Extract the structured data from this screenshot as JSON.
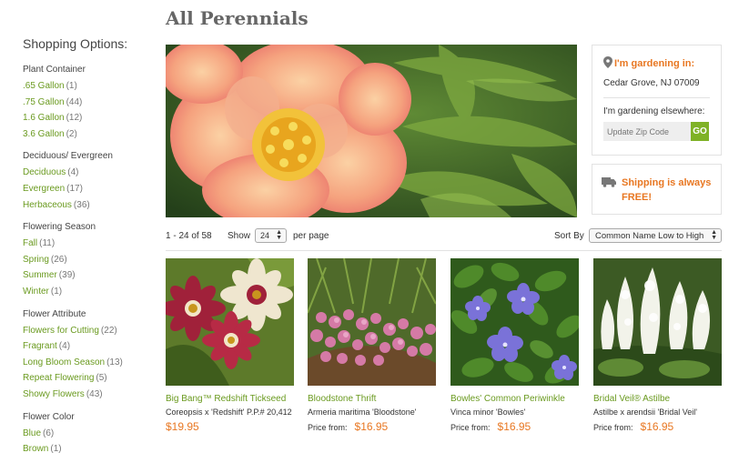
{
  "page_title": "All Perennials",
  "sidebar": {
    "heading": "Shopping Options:",
    "groups": [
      {
        "title": "Plant Container",
        "options": [
          {
            "label": ".65 Gallon",
            "count": "(1)"
          },
          {
            "label": ".75 Gallon",
            "count": "(44)"
          },
          {
            "label": "1.6 Gallon",
            "count": "(12)"
          },
          {
            "label": "3.6 Gallon",
            "count": "(2)"
          }
        ]
      },
      {
        "title": "Deciduous/ Evergreen",
        "options": [
          {
            "label": "Deciduous",
            "count": "(4)"
          },
          {
            "label": "Evergreen",
            "count": "(17)"
          },
          {
            "label": "Herbaceous",
            "count": "(36)"
          }
        ]
      },
      {
        "title": "Flowering Season",
        "options": [
          {
            "label": "Fall",
            "count": "(11)"
          },
          {
            "label": "Spring",
            "count": "(26)"
          },
          {
            "label": "Summer",
            "count": "(39)"
          },
          {
            "label": "Winter",
            "count": "(1)"
          }
        ]
      },
      {
        "title": "Flower Attribute",
        "options": [
          {
            "label": "Flowers for Cutting",
            "count": "(22)"
          },
          {
            "label": "Fragrant",
            "count": "(4)"
          },
          {
            "label": "Long Bloom Season",
            "count": "(13)"
          },
          {
            "label": "Repeat Flowering",
            "count": "(5)"
          },
          {
            "label": "Showy Flowers",
            "count": "(43)"
          }
        ]
      },
      {
        "title": "Flower Color",
        "options": [
          {
            "label": "Blue",
            "count": "(6)"
          },
          {
            "label": "Brown",
            "count": "(1)"
          }
        ]
      }
    ]
  },
  "location": {
    "icon": "map-pin-icon",
    "heading": "I'm gardening in:",
    "city": "Cedar Grove, NJ 07009",
    "elsewhere_label": "I'm gardening elsewhere:",
    "zip_placeholder": "Update Zip Code",
    "go_label": "GO"
  },
  "shipping": {
    "icon": "truck-icon",
    "text_line1": "Shipping is always",
    "text_line2": "FREE!"
  },
  "toolbar": {
    "range": "1 - 24 of 58",
    "show_label": "Show",
    "per_page_value": "24",
    "per_page_label": "per page",
    "sort_label": "Sort By",
    "sort_value": "Common Name Low to High"
  },
  "products": [
    {
      "name": "Big Bang™ Redshift Tickseed",
      "botanical": "Coreopsis x 'Redshift' P.P.# 20,412",
      "price_from": "",
      "price": "$19.95"
    },
    {
      "name": "Bloodstone Thrift",
      "botanical": "Armeria maritima 'Bloodstone'",
      "price_from": "Price from:",
      "price": "$16.95"
    },
    {
      "name": "Bowles' Common Periwinkle",
      "botanical": "Vinca minor 'Bowles'",
      "price_from": "Price from:",
      "price": "$16.95"
    },
    {
      "name": "Bridal Veil® Astilbe",
      "botanical": "Astilbe x arendsii 'Bridal Veil'",
      "price_from": "Price from:",
      "price": "$16.95"
    }
  ],
  "colors": {
    "accent_orange": "#e87722",
    "link_green": "#6a9a1f",
    "go_green": "#7fb226"
  }
}
